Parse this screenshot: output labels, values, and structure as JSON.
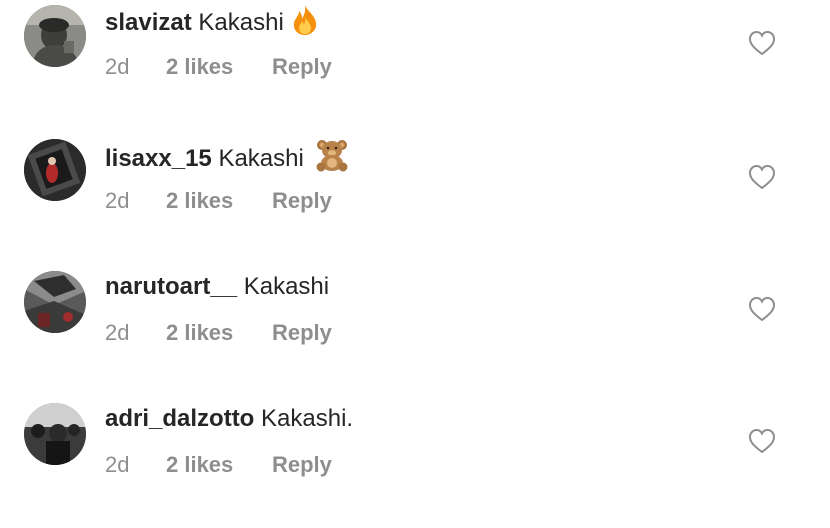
{
  "comments": [
    {
      "username": "slavizat",
      "text": "Kakashi",
      "emoji": "fire-emoji",
      "time": "2d",
      "likes": "2 likes",
      "reply": "Reply"
    },
    {
      "username": "lisaxx_15",
      "text": "Kakashi",
      "emoji": "teddy-bear-emoji",
      "time": "2d",
      "likes": "2 likes",
      "reply": "Reply"
    },
    {
      "username": "narutoart__",
      "text": "Kakashi",
      "emoji": "",
      "time": "2d",
      "likes": "2 likes",
      "reply": "Reply"
    },
    {
      "username": "adri_dalzotto",
      "text": "Kakashi.",
      "emoji": "",
      "time": "2d",
      "likes": "2 likes",
      "reply": "Reply"
    }
  ],
  "colors": {
    "primary_text": "#262626",
    "secondary_text": "#8e8e8e",
    "heart_outline": "#8e8e8e"
  }
}
